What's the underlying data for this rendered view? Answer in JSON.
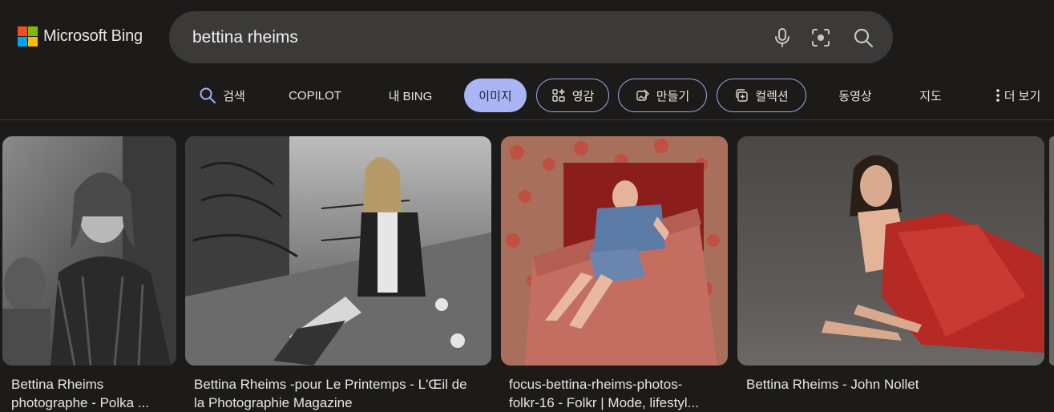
{
  "header": {
    "brand": "Microsoft Bing",
    "search_value": "bettina rheims"
  },
  "icons": {
    "mic": "microphone-icon",
    "visual": "visual-search-icon",
    "search": "search-icon"
  },
  "nav": {
    "search": "검색",
    "copilot": "COPILOT",
    "my_bing": "내 BING",
    "images": "이미지",
    "inspiration": "영감",
    "create": "만들기",
    "collections": "컬렉션",
    "videos": "동영상",
    "maps": "지도",
    "more": "더 보기"
  },
  "colors": {
    "background": "#1c1b1a",
    "search_bar": "#3b3a39",
    "active_tab": "#a9b5f5",
    "pill_border": "#9aa6e6"
  },
  "results": [
    {
      "line1": "Bettina Rheims",
      "line2": "photographe - Polka ..."
    },
    {
      "line1": "Bettina Rheims -pour Le Printemps - L'Œil de",
      "line2": "la Photographie Magazine"
    },
    {
      "line1": "focus-bettina-rheims-photos-",
      "line2": "folkr-16 - Folkr | Mode, lifestyl..."
    },
    {
      "line1": "Bettina Rheims - John Nollet",
      "line2": ""
    }
  ]
}
